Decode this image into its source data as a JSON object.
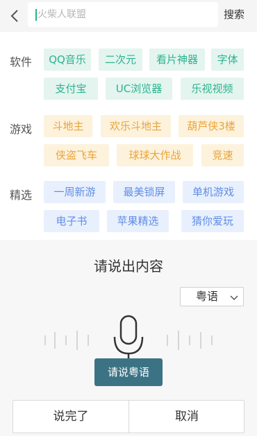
{
  "header": {
    "search_placeholder": "火柴人联盟",
    "search_button": "搜索"
  },
  "categories": [
    {
      "label": "软件",
      "color": "#2ab48f",
      "tags": [
        "QQ音乐",
        "二次元",
        "看片神器",
        "字体",
        "支付宝",
        "UC浏览器",
        "乐视视频"
      ]
    },
    {
      "label": "游戏",
      "color": "#e9a43a",
      "tags": [
        "斗地主",
        "欢乐斗地主",
        "葫芦侠3楼",
        "侠盗飞车",
        "球球大作战",
        "竞速"
      ]
    },
    {
      "label": "精选",
      "color": "#5f8ee5",
      "tags": [
        "一周新游",
        "最美锁屏",
        "单机游戏",
        "电子书",
        "苹果精选",
        "猜你爱玩"
      ]
    }
  ],
  "voice": {
    "title": "请说出内容",
    "language": "粤语",
    "speak_label": "请说粤语",
    "done_button": "说完了",
    "cancel_button": "取消"
  }
}
